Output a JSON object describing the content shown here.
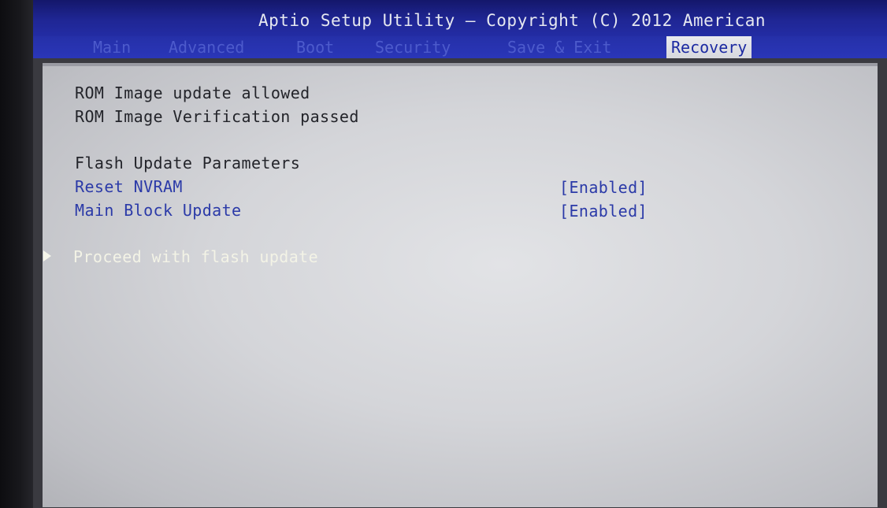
{
  "title": "Aptio Setup Utility – Copyright (C) 2012 American",
  "tabs": [
    {
      "label": "Main",
      "active": false
    },
    {
      "label": "Advanced",
      "active": false
    },
    {
      "label": "Boot",
      "active": false
    },
    {
      "label": "Security",
      "active": false
    },
    {
      "label": "Save & Exit",
      "active": false
    },
    {
      "label": "Recovery",
      "active": true
    }
  ],
  "status_lines": [
    "ROM Image update allowed",
    "ROM Image Verification passed"
  ],
  "section_heading": "Flash Update Parameters",
  "settings": [
    {
      "label": "Reset NVRAM",
      "value": "[Enabled]"
    },
    {
      "label": "Main Block Update",
      "value": "[Enabled]"
    }
  ],
  "action": {
    "label": "Proceed with flash update",
    "icon": "triangle-right-icon"
  },
  "colors": {
    "title_bar": "#1f2694",
    "panel": "#d4d5d9",
    "option_text": "#2b3aa8",
    "action_text": "#f3f3e6",
    "active_tab_bg": "#e9eaee"
  }
}
